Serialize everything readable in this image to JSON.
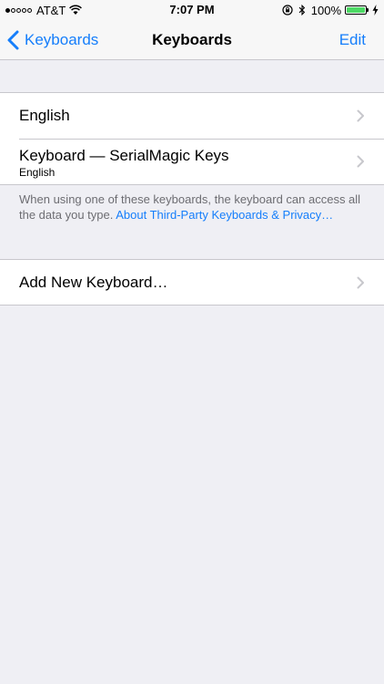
{
  "status_bar": {
    "carrier": "AT&T",
    "time": "7:07 PM",
    "battery_percent": "100%",
    "battery_level": 1.0,
    "signal_bars": 1
  },
  "nav": {
    "back_label": "Keyboards",
    "title": "Keyboards",
    "edit_label": "Edit"
  },
  "keyboards": [
    {
      "label": "English"
    },
    {
      "label": "Keyboard — SerialMagic Keys",
      "sublabel": "English"
    }
  ],
  "footer": {
    "text": "When using one of these keyboards, the keyboard can access all the data you type. ",
    "link": "About Third-Party Keyboards & Privacy…"
  },
  "add_keyboard": {
    "label": "Add New Keyboard…"
  },
  "colors": {
    "accent": "#157EFB",
    "background": "#EFEFF4",
    "battery": "#4CD964"
  }
}
